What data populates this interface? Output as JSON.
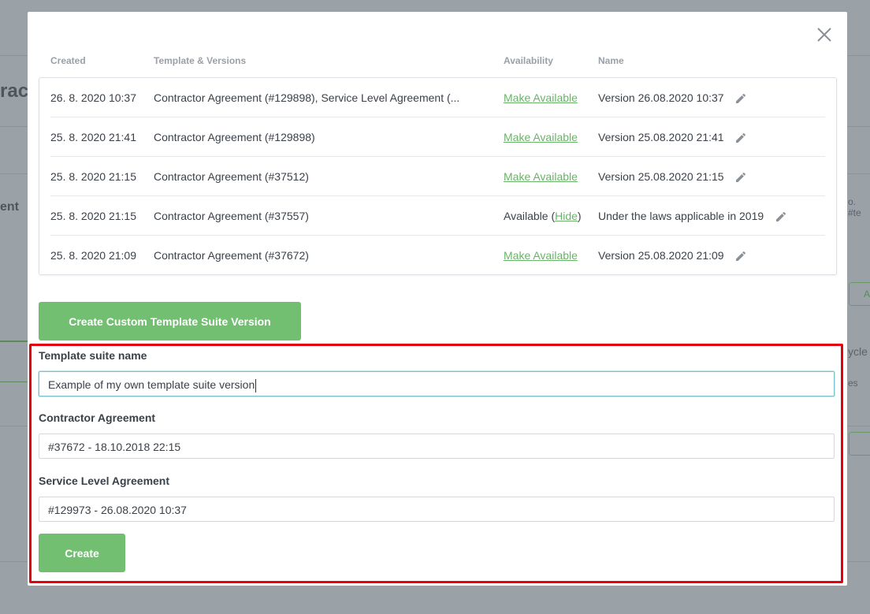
{
  "background": {
    "fragments": [
      "ract",
      "ent",
      "o. #te",
      "ycle",
      "es",
      "A"
    ]
  },
  "modal": {
    "close_icon": "close-icon",
    "columns": {
      "created": "Created",
      "template": "Template & Versions",
      "availability": "Availability",
      "name": "Name"
    },
    "rows": [
      {
        "created": "26. 8. 2020 10:37",
        "template": "Contractor Agreement (#129898), Service Level Agreement (...",
        "availability_link": "Make Available",
        "name": "Version 26.08.2020 10:37"
      },
      {
        "created": "25. 8. 2020 21:41",
        "template": "Contractor Agreement (#129898)",
        "availability_link": "Make Available",
        "name": "Version 25.08.2020 21:41"
      },
      {
        "created": "25. 8. 2020 21:15",
        "template": "Contractor Agreement (#37512)",
        "availability_link": "Make Available",
        "name": "Version 25.08.2020 21:15"
      },
      {
        "created": "25. 8. 2020 21:15",
        "template": "Contractor Agreement (#37557)",
        "availability_prefix": "Available (",
        "availability_link": "Hide",
        "availability_suffix": ")",
        "name": "Under the laws applicable in 2019"
      },
      {
        "created": "25. 8. 2020 21:09",
        "template": "Contractor Agreement (#37672)",
        "availability_link": "Make Available",
        "name": "Version 25.08.2020 21:09"
      }
    ],
    "create_custom_label": "Create Custom Template Suite Version",
    "form": {
      "suite_name_label": "Template suite name",
      "suite_name_value": "Example of my own template suite version",
      "contractor_label": "Contractor Agreement",
      "contractor_value": "#37672 - 18.10.2018 22:15",
      "sla_label": "Service Level Agreement",
      "sla_value": "#129973 - 26.08.2020 10:37",
      "create_label": "Create"
    }
  },
  "colors": {
    "accent_green": "#72bf72",
    "link_green": "#6bb36a",
    "highlight_red": "#e3000f"
  }
}
